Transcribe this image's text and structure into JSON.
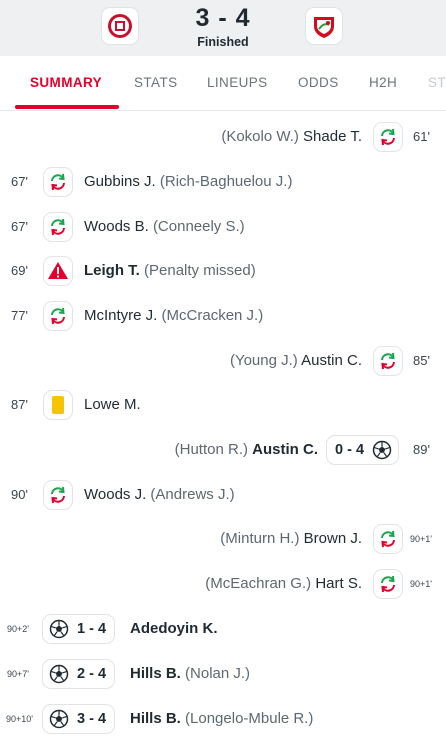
{
  "header": {
    "score": "3 - 4",
    "status": "Finished"
  },
  "tabs": [
    "SUMMARY",
    "STATS",
    "LINEUPS",
    "ODDS",
    "H2H",
    "ST"
  ],
  "events": [
    {
      "minute": "61'",
      "player": "Shade T.",
      "detail": "(Kokolo W.)",
      "type": "substitution",
      "side": "away"
    },
    {
      "minute": "67'",
      "player": "Gubbins J.",
      "detail": "(Rich-Baghuelou J.)",
      "type": "substitution",
      "side": "home"
    },
    {
      "minute": "67'",
      "player": "Woods B.",
      "detail": "(Conneely S.)",
      "type": "substitution",
      "side": "home"
    },
    {
      "minute": "69'",
      "player": "Leigh T.",
      "detail": "(Penalty missed)",
      "type": "penalty-missed",
      "side": "home"
    },
    {
      "minute": "77'",
      "player": "McIntyre J.",
      "detail": "(McCracken J.)",
      "type": "substitution",
      "side": "home"
    },
    {
      "minute": "85'",
      "player": "Austin C.",
      "detail": "(Young J.)",
      "type": "substitution",
      "side": "away"
    },
    {
      "minute": "87'",
      "player": "Lowe M.",
      "detail": "",
      "type": "yellow-card",
      "side": "home"
    },
    {
      "minute": "89'",
      "player": "Austin C.",
      "detail": "(Hutton R.)",
      "type": "goal",
      "score": "0 - 4",
      "side": "away"
    },
    {
      "minute": "90'",
      "player": "Woods J.",
      "detail": "(Andrews J.)",
      "type": "substitution",
      "side": "home"
    },
    {
      "minute": "90+1'",
      "player": "Brown J.",
      "detail": "(Minturn H.)",
      "type": "substitution",
      "side": "away"
    },
    {
      "minute": "90+1'",
      "player": "Hart S.",
      "detail": "(McEachran G.)",
      "type": "substitution",
      "side": "away"
    },
    {
      "minute": "90+2'",
      "player": "Adedoyin K.",
      "detail": "",
      "type": "goal",
      "score": "1 - 4",
      "side": "home"
    },
    {
      "minute": "90+7'",
      "player": "Hills B.",
      "detail": "(Nolan J.)",
      "type": "goal",
      "score": "2 - 4",
      "side": "home"
    },
    {
      "minute": "90+10'",
      "player": "Hills B.",
      "detail": "(Longelo-Mbule R.)",
      "type": "goal",
      "score": "3 - 4",
      "side": "home"
    }
  ],
  "colors": {
    "accent": "#e4002b",
    "sub_green": "#1aa64a",
    "sub_red": "#e4002b",
    "yellow_card": "#f7c400",
    "penalty_red": "#e4002b"
  }
}
